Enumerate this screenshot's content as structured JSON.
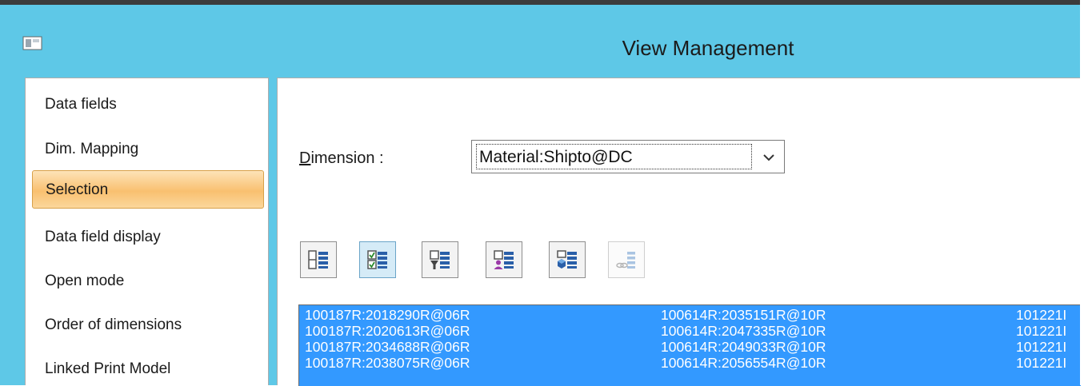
{
  "window": {
    "title": "View Management"
  },
  "nav": {
    "items": [
      {
        "label": "Data fields"
      },
      {
        "label": "Dim. Mapping"
      },
      {
        "label": "Selection"
      },
      {
        "label": "Data field display"
      },
      {
        "label": "Open mode"
      },
      {
        "label": "Order of dimensions"
      },
      {
        "label": "Linked Print Model"
      }
    ],
    "selected_index": 2
  },
  "dimension": {
    "label_mnemonic": "D",
    "label_rest": "imension :",
    "value": "Material:Shipto@DC"
  },
  "toolbar": {
    "buttons": [
      {
        "icon": "list-view-icon",
        "state": "normal"
      },
      {
        "icon": "checklist-view-icon",
        "state": "active"
      },
      {
        "icon": "filter-list-icon",
        "state": "normal"
      },
      {
        "icon": "user-list-icon",
        "state": "normal"
      },
      {
        "icon": "cube-list-icon",
        "state": "normal"
      },
      {
        "icon": "link-list-icon",
        "state": "disabled"
      }
    ]
  },
  "list": {
    "columns": [
      [
        "100187R:2018290R@06R",
        "100187R:2020613R@06R",
        "100187R:2034688R@06R",
        "100187R:2038075R@06R"
      ],
      [
        "100614R:2035151R@10R",
        "100614R:2047335R@10R",
        "100614R:2049033R@10R",
        "100614R:2056554R@10R"
      ],
      [
        "101221I",
        "101221I",
        "101221I",
        "101221I"
      ]
    ]
  },
  "colors": {
    "titlebar": "#5ec8e7",
    "selection": "#3399ff",
    "nav_highlight": "#f9c070"
  }
}
